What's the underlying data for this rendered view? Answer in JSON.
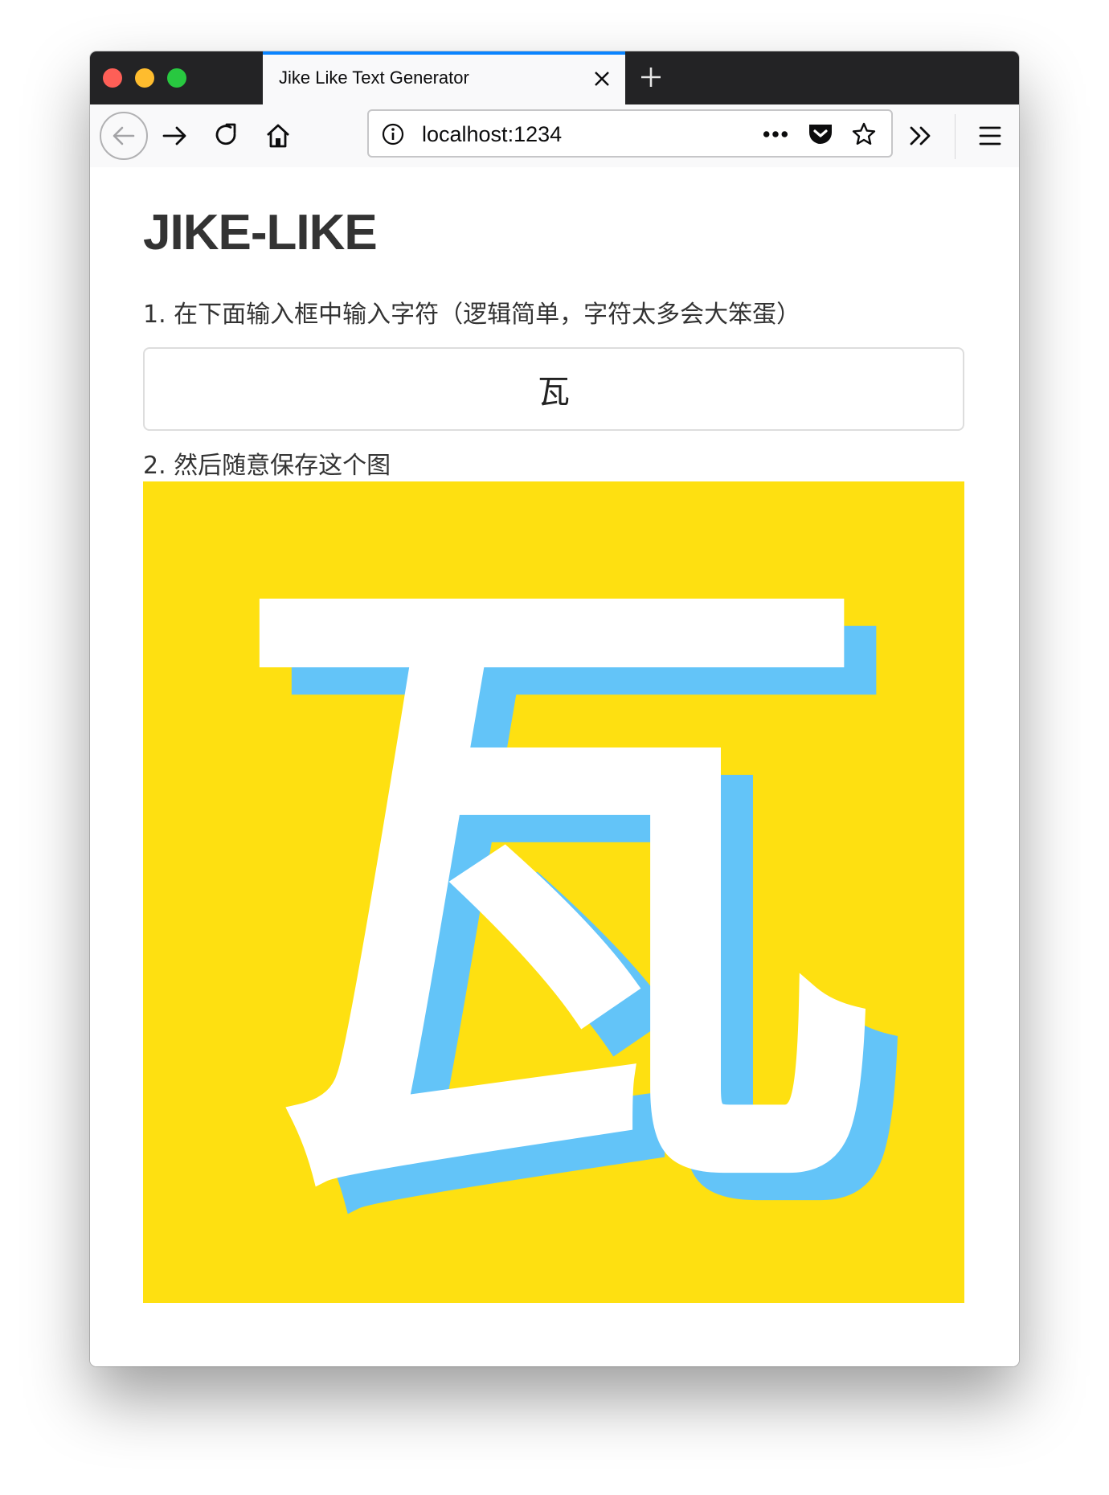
{
  "browser": {
    "tab_title": "Jike Like Text Generator",
    "url": "localhost:1234",
    "icons": [
      "back-arrow-icon",
      "forward-arrow-icon",
      "reload-icon",
      "home-icon",
      "info-icon",
      "more-dots-icon",
      "pocket-icon",
      "bookmark-star-icon",
      "overflow-chevrons-icon",
      "hamburger-menu-icon",
      "close-icon",
      "plus-icon"
    ],
    "accent_color": "#0a84ff"
  },
  "page": {
    "title": "JIKE-LIKE",
    "step1": "1. 在下面输入框中输入字符（逻辑简单，字符太多会大笨蛋）",
    "input_value": "瓦",
    "step2": "2. 然后随意保存这个图"
  },
  "canvas": {
    "character": "瓦",
    "background_color": "#fee011",
    "text_color": "#ffffff",
    "shadow_color": "#63c4f8"
  }
}
